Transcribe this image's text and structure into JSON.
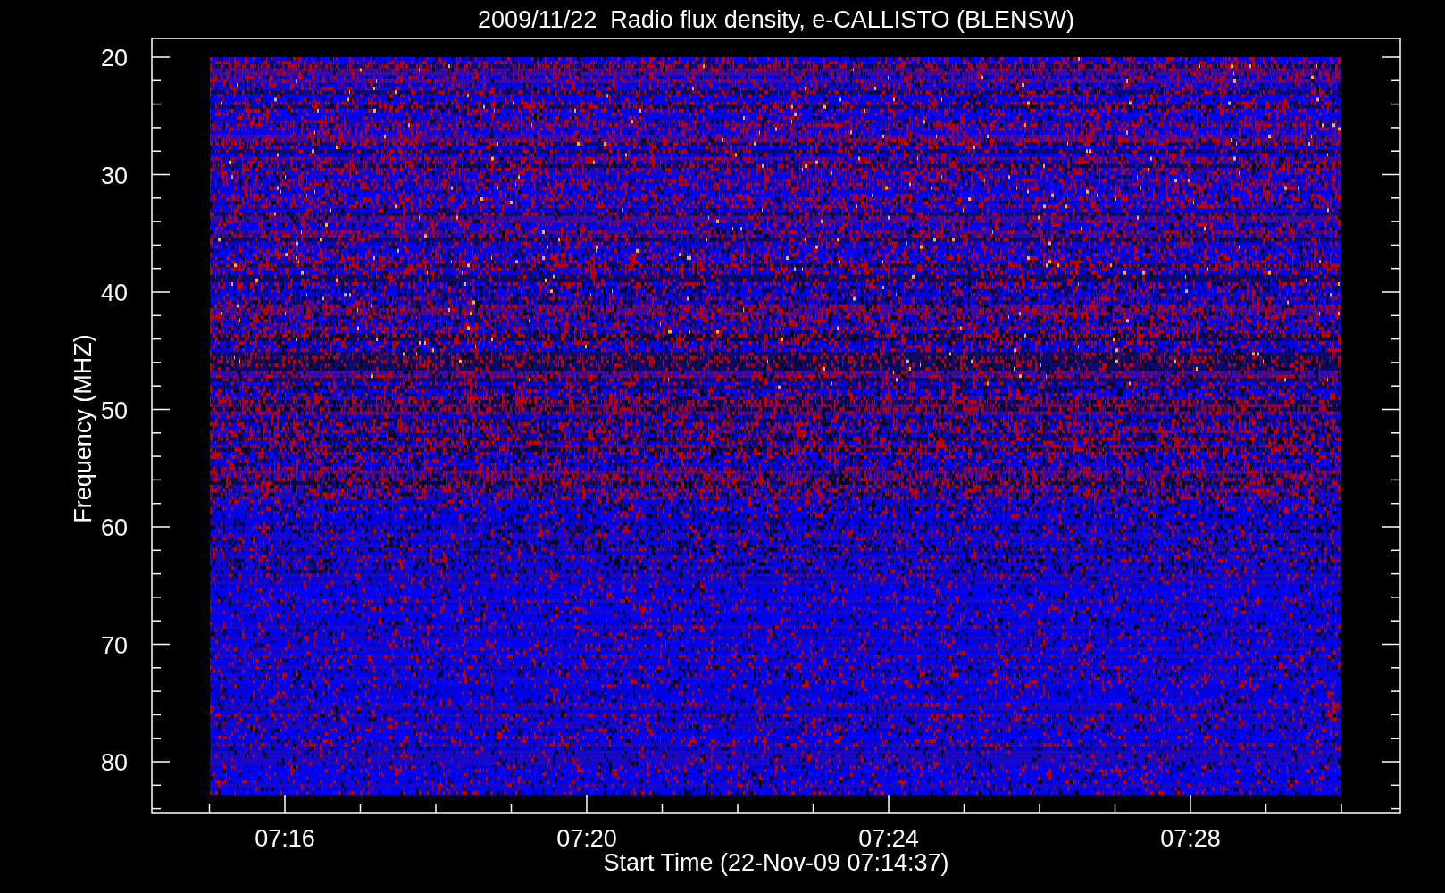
{
  "title": "2009/11/22  Radio flux density, e-CALLISTO (BLENSW)",
  "y_axis": {
    "label": "Frequency (MHZ)",
    "ticks": [
      "20",
      "30",
      "40",
      "50",
      "60",
      "70",
      "80"
    ]
  },
  "x_axis": {
    "label": "Start Time (22-Nov-09 07:14:37)",
    "ticks": [
      "07:16",
      "07:20",
      "07:24",
      "07:28"
    ]
  }
}
